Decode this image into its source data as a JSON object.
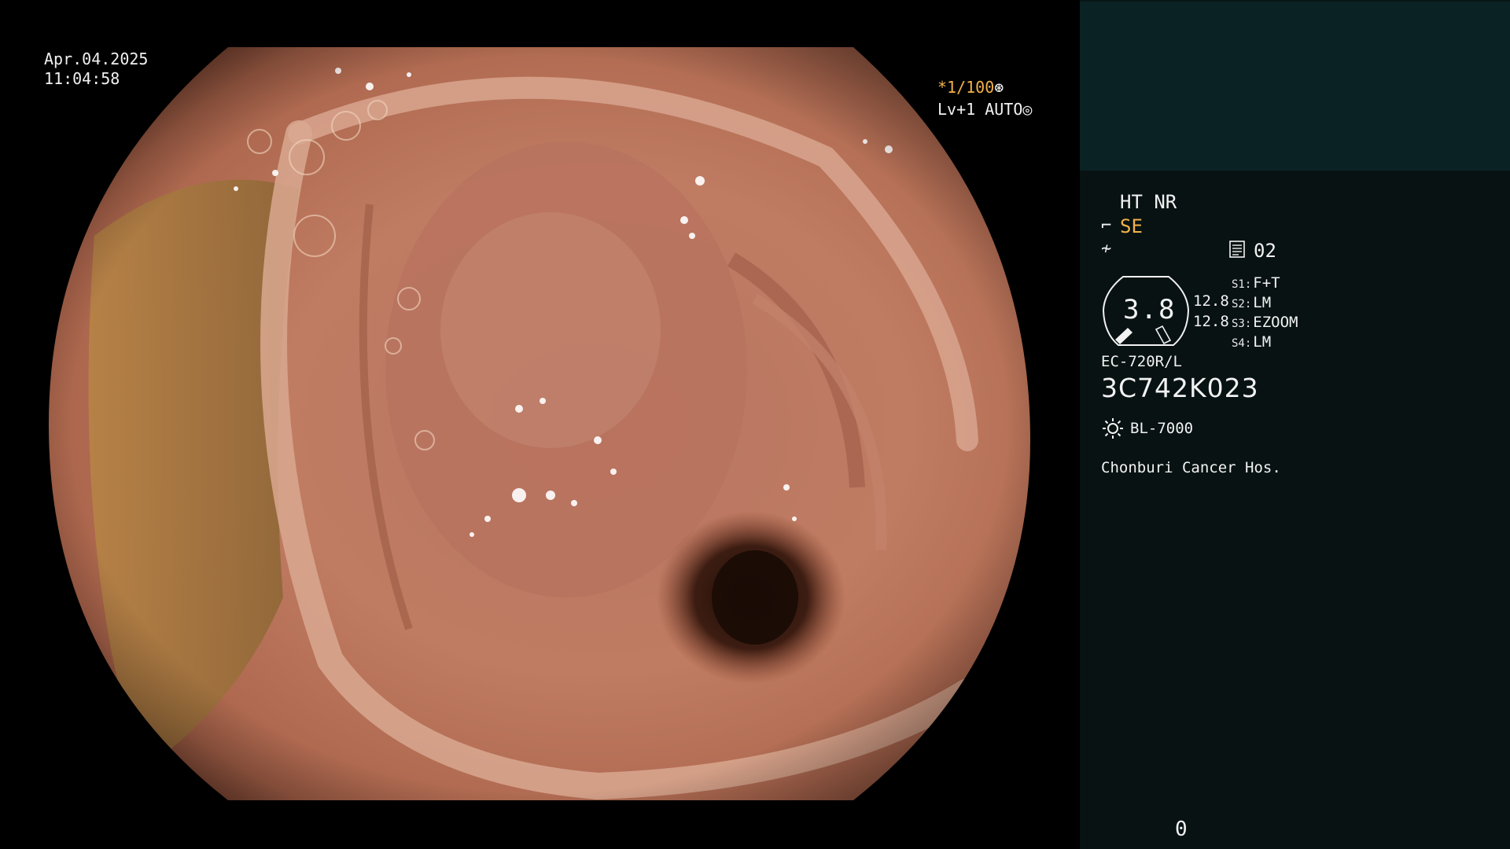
{
  "osd": {
    "date": "Apr.04.2025",
    "time": "11:04:58",
    "shutter_prefix": "*",
    "shutter": "1/100",
    "shutter_icon": "aperture-icon",
    "level": "Lv+1 AUTO",
    "level_icon": "iris-icon"
  },
  "panel": {
    "enhancement": "HT NR",
    "structure_mode": "SE",
    "structure_mode_color": "#f2b24a",
    "mode_icon_1": "structure-icon",
    "mode_icon_2": "color-mode-icon",
    "memo_icon": "memo-icon",
    "memo_value": "02",
    "zoom": "3.8",
    "magnification_top": "12.8",
    "magnification_bottom": "12.8",
    "switches": [
      {
        "key": "S1:",
        "value": "F+T"
      },
      {
        "key": "S2:",
        "value": "LM"
      },
      {
        "key": "S3:",
        "value": "EZOOM"
      },
      {
        "key": "S4:",
        "value": "LM"
      }
    ],
    "scope_model": "EC-720R/L",
    "scope_serial": "3C742K023",
    "light_icon": "lamp-icon",
    "light_source": "BL-7000",
    "hospital": "Chonburi Cancer Hos.",
    "counter": "0"
  },
  "colors": {
    "panel_bg": "#081213",
    "thumb_bg": "#0b2224",
    "accent": "#f2b24a"
  }
}
